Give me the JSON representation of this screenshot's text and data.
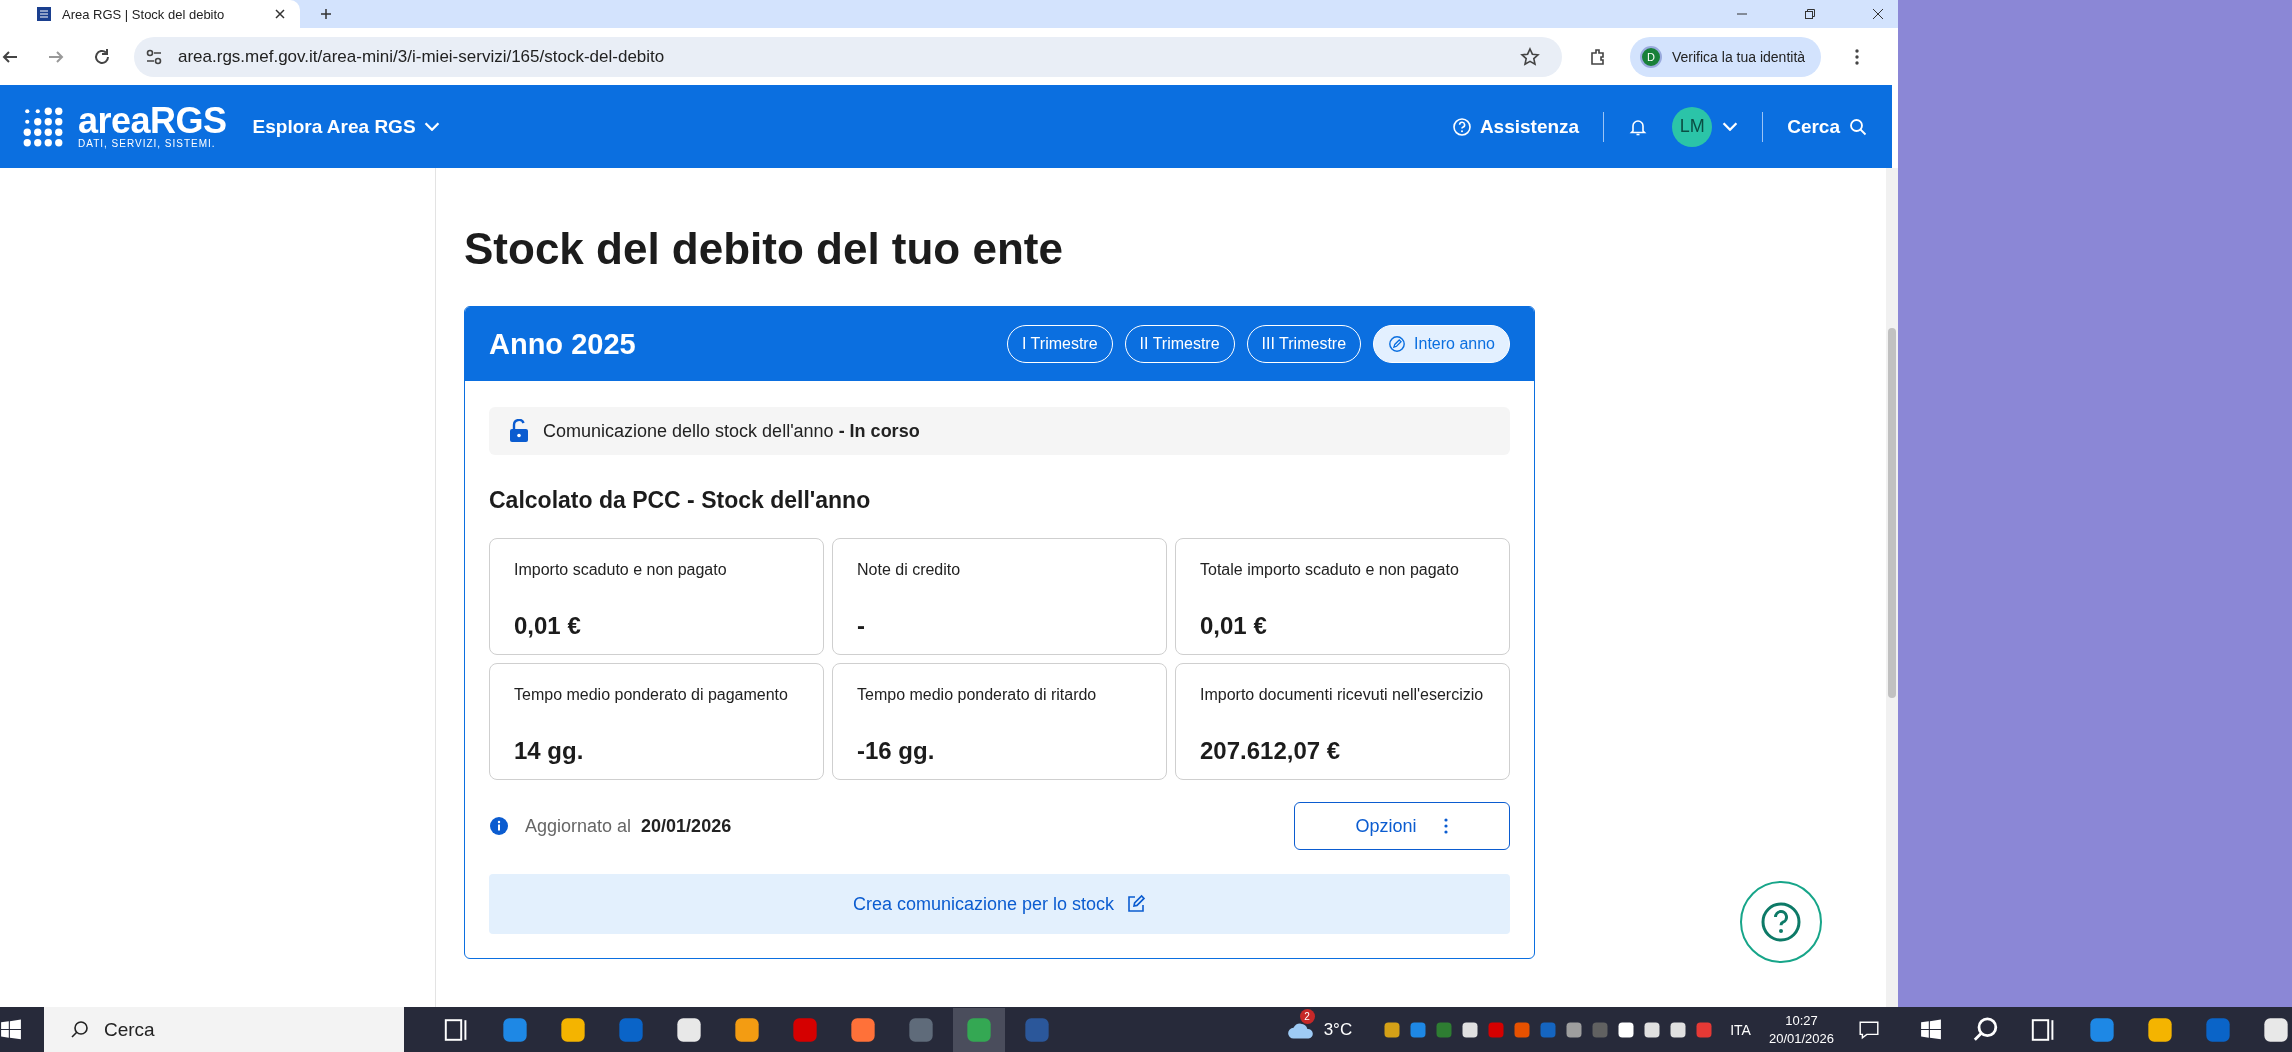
{
  "browser": {
    "tab_title": "Area RGS | Stock del debito",
    "url": "area.rgs.mef.gov.it/area-mini/3/i-miei-servizi/165/stock-del-debito",
    "profile_badge": "D",
    "profile_button": "Verifica la tua identità"
  },
  "header": {
    "logo": "areaRGS",
    "logo_tagline": "DATI, SERVIZI, SISTEMI.",
    "nav": "Esplora Area RGS",
    "help": "Assistenza",
    "avatar": "LM",
    "search": "Cerca"
  },
  "page_title": "Stock del debito del tuo ente",
  "card": {
    "year": "Anno 2025",
    "periods": [
      {
        "label": "I Trimestre",
        "selected": false
      },
      {
        "label": "II Trimestre",
        "selected": false
      },
      {
        "label": "III Trimestre",
        "selected": false
      },
      {
        "label": "Intero anno",
        "selected": true
      }
    ],
    "status": "Comunicazione dello stock dell'anno **- In corso**",
    "section_title": "Calcolato da PCC - Stock dell'anno",
    "metrics": [
      {
        "label": "Importo scaduto e non pagato",
        "value": "0,01 €"
      },
      {
        "label": "Note di credito",
        "value": "-"
      },
      {
        "label": "Totale importo scaduto e non pagato",
        "value": "0,01 €"
      },
      {
        "label": "Tempo medio ponderato di pagamento",
        "value": "14 gg."
      },
      {
        "label": "Tempo medio ponderato di ritardo",
        "value": "-16 gg."
      },
      {
        "label": "Importo documenti ricevuti nell'esercizio",
        "value": "207.612,07 €"
      }
    ],
    "updated_label": "Aggiornato al",
    "updated_date": "20/01/2026",
    "options_button": "Opzioni",
    "create_button": "Crea comunicazione per lo stock"
  },
  "taskbar": {
    "search": "Cerca",
    "weather_badge": "2",
    "temperature": "3°C",
    "language": "ITA",
    "time": "10:27",
    "date": "20/01/2026"
  }
}
